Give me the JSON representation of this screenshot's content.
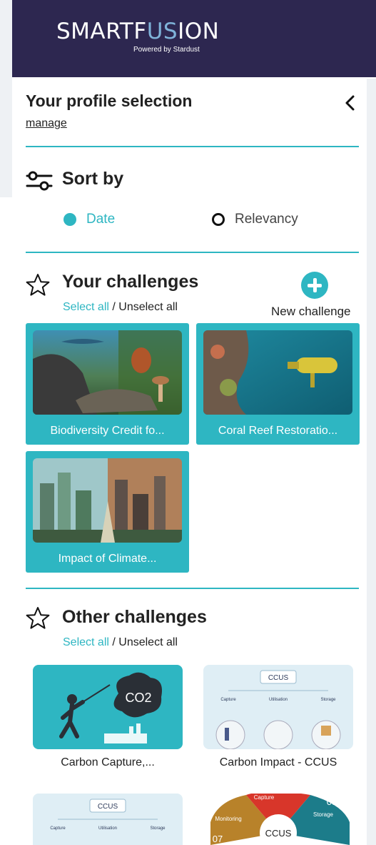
{
  "brand": {
    "name_start": "SMARTF",
    "name_accent": "US",
    "name_end": "ION",
    "tagline": "Powered by Stardust"
  },
  "profile": {
    "title": "Your profile selection",
    "manage_link": "manage"
  },
  "sort": {
    "title": "Sort by",
    "options": [
      {
        "label": "Date",
        "selected": true
      },
      {
        "label": "Relevancy",
        "selected": false
      }
    ]
  },
  "your_challenges": {
    "title": "Your challenges",
    "select_all": "Select all",
    "separator": " / ",
    "unselect_all": "Unselect all",
    "new_challenge_label": "New challenge",
    "items": [
      {
        "title": "Biodiversity Credit fo..."
      },
      {
        "title": "Coral Reef Restoratio..."
      },
      {
        "title": "Impact of Climate..."
      }
    ]
  },
  "other_challenges": {
    "title": "Other challenges",
    "select_all": "Select all",
    "separator": " / ",
    "unselect_all": "Unselect all",
    "items": [
      {
        "title": "Carbon Capture,...",
        "thumb_text": "CO2"
      },
      {
        "title": "Carbon Impact - CCUS",
        "thumb_text": "CCUS",
        "thumb_cols": [
          "Capture",
          "Utilisation",
          "Storage"
        ]
      },
      {
        "title": "",
        "thumb_text": "CCUS",
        "thumb_cols": [
          "Capture",
          "Utilisation",
          "Storage"
        ]
      },
      {
        "title": "",
        "thumb_text": "CCUS",
        "thumb_labels": [
          "Capture",
          "Monitoring",
          "Storage",
          "03",
          "07"
        ]
      }
    ]
  },
  "colors": {
    "header_bg": "#2d2750",
    "accent": "#2eb6c2",
    "text": "#222222"
  }
}
